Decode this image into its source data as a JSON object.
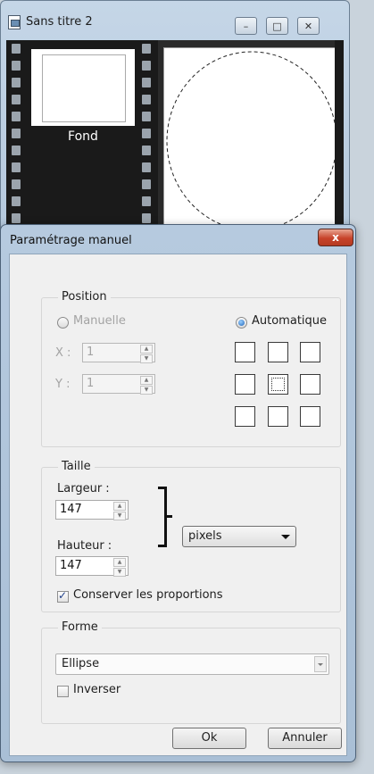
{
  "doc_window": {
    "title": "Sans titre 2",
    "thumb_label": "Fond",
    "buttons": {
      "minimize": "–",
      "maximize": "□",
      "close": "✕"
    }
  },
  "dialog": {
    "title": "Paramétrage manuel",
    "close": "x",
    "position": {
      "legend": "Position",
      "manual_label": "Manuelle",
      "auto_label": "Automatique",
      "selected": "Automatique",
      "x_label": "X :",
      "x_value": "1",
      "y_label": "Y :",
      "y_value": "1",
      "anchor_selected": "center"
    },
    "size": {
      "legend": "Taille",
      "width_label": "Largeur :",
      "width_value": "147",
      "height_label": "Hauteur :",
      "height_value": "147",
      "unit": "pixels",
      "keep_proportions_label": "Conserver les proportions",
      "keep_proportions": true
    },
    "shape": {
      "legend": "Forme",
      "value": "Ellipse",
      "invert_label": "Inverser",
      "invert": false
    },
    "ok_label": "Ok",
    "cancel_label": "Annuler"
  }
}
